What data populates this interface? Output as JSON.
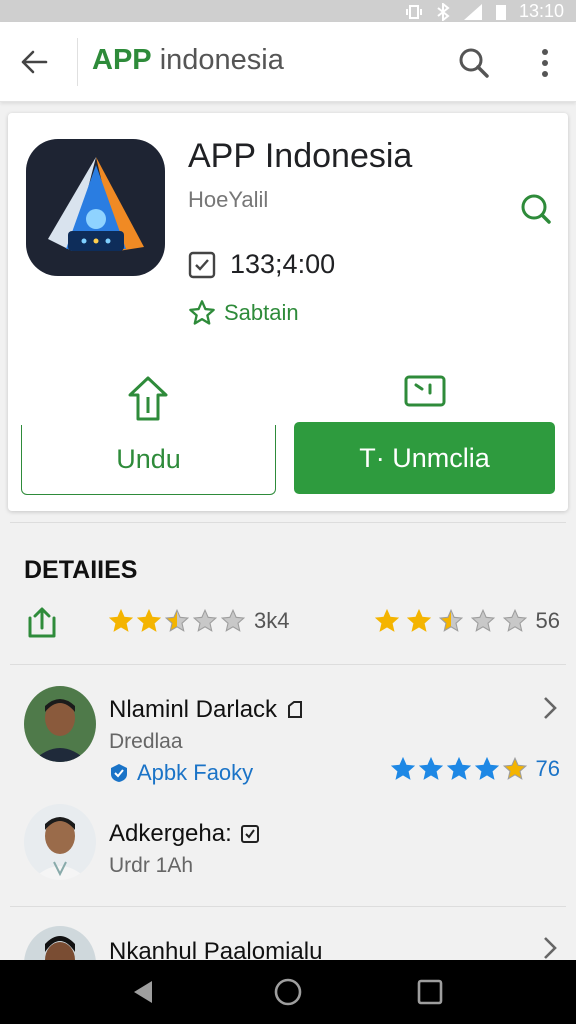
{
  "status_bar": {
    "time": "13:10"
  },
  "app_bar": {
    "search_accent": "APP",
    "search_rest": " indonesia"
  },
  "app": {
    "title": "APP Indonesia",
    "developer": "HoeYalil",
    "info_value": "133;4:00",
    "badge_label": "Sabtain",
    "install_label": "Undu",
    "open_label": "T· Unmclia"
  },
  "details": {
    "title": "DETAIIES",
    "rating_left": {
      "stars": 2.5,
      "value": "3k4"
    },
    "rating_right": {
      "stars": 2.5,
      "value": "56"
    }
  },
  "reviews": [
    {
      "name": "Nlaminl Darlack",
      "sub": "Dredlaa",
      "link": "Apbk Faoky",
      "stars": 4,
      "score": "76"
    },
    {
      "name": "Adkergeha:",
      "sub": "Urdr 1Ah"
    },
    {
      "name": "Nkanhul Paalomialu"
    }
  ],
  "colors": {
    "accent": "#2e8b3a",
    "button": "#2e9b3e",
    "link": "#1a73c7",
    "star": "#f4b400",
    "star_blue": "#1e88e5"
  }
}
